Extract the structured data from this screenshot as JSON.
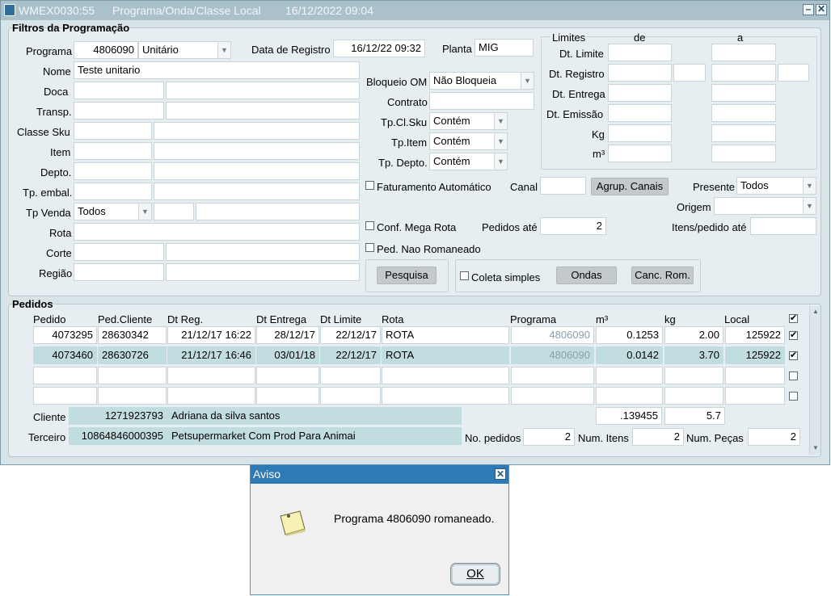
{
  "window": {
    "code": "WMEX0030:55",
    "title": "Programa/Onda/Classe Local",
    "datetime": "16/12/2022 09:04"
  },
  "filtros": {
    "title": "Filtros da Programação",
    "programa_label": "Programa",
    "programa_value": "4806090",
    "tipo_value": "Unitário",
    "data_registro_label": "Data de Registro",
    "data_registro_value": "16/12/22 09:32",
    "planta_label": "Planta",
    "planta_value": "MIG",
    "nome_label": "Nome",
    "nome_value": "Teste unitario",
    "doca_label": "Doca",
    "transp_label": "Transp.",
    "classe_sku_label": "Classe Sku",
    "item_label": "Item",
    "depto_label": "Depto.",
    "tp_embal_label": "Tp. embal.",
    "tp_venda_label": "Tp Venda",
    "tp_venda_value": "Todos",
    "rota_label": "Rota",
    "corte_label": "Corte",
    "regiao_label": "Região",
    "bloqueio_om_label": "Bloqueio OM",
    "bloqueio_om_value": "Não Bloqueia",
    "contrato_label": "Contrato",
    "tp_cl_sku_label": "Tp.Cl.Sku",
    "tp_cl_sku_value": "Contém",
    "tp_item_label": "Tp.Item",
    "tp_item_value": "Contém",
    "tp_depto_label": "Tp. Depto.",
    "tp_depto_value": "Contém",
    "limites_label": "Limites",
    "de_label": "de",
    "a_label": "a",
    "dt_limite_label": "Dt. Limite",
    "dt_registro_label": "Dt. Registro",
    "dt_entrega_label": "Dt. Entrega",
    "dt_emissao_label": "Dt. Emissão",
    "kg_label": "Kg",
    "m3_label": "m³",
    "faturamento_label": "Faturamento Automático",
    "faturamento_checked": false,
    "canal_label": "Canal",
    "agrup_canais_label": "Agrup. Canais",
    "presente_label": "Presente",
    "presente_value": "Todos",
    "origem_label": "Origem",
    "conf_mega_rota_label": "Conf. Mega Rota",
    "conf_mega_rota_checked": false,
    "pedidos_ate_label": "Pedidos até",
    "pedidos_ate_value": "2",
    "itens_pedido_label": "Itens/pedido até",
    "ped_nao_romaneado_label": "Ped. Nao Romaneado",
    "ped_nao_romaneado_checked": false,
    "pesquisa_label": "Pesquisa",
    "coleta_simples_label": "Coleta simples",
    "coleta_simples_checked": false,
    "ondas_label": "Ondas",
    "canc_rom_label": "Canc. Rom."
  },
  "pedidos": {
    "title": "Pedidos",
    "columns": [
      "Pedido",
      "Ped.Cliente",
      "Dt Reg.",
      "Dt Entrega",
      "Dt Limite",
      "Rota",
      "Programa",
      "m³",
      "kg",
      "Local"
    ],
    "header_checked": true,
    "rows": [
      {
        "pedido": "4073295",
        "ped_cliente": "28630342",
        "dt_reg": "21/12/17 16:22",
        "dt_entrega": "28/12/17",
        "dt_limite": "22/12/17",
        "rota": "ROTA",
        "programa": "4806090",
        "m3": "0.1253",
        "kg": "2.00",
        "local": "125922",
        "checked": true
      },
      {
        "pedido": "4073460",
        "ped_cliente": "28630726",
        "dt_reg": "21/12/17 16:46",
        "dt_entrega": "03/01/18",
        "dt_limite": "22/12/17",
        "rota": "ROTA",
        "programa": "4806090",
        "m3": "0.0142",
        "kg": "3.70",
        "local": "125922",
        "checked": true
      },
      {
        "pedido": "",
        "ped_cliente": "",
        "dt_reg": "",
        "dt_entrega": "",
        "dt_limite": "",
        "rota": "",
        "programa": "",
        "m3": "",
        "kg": "",
        "local": "",
        "checked": false
      },
      {
        "pedido": "",
        "ped_cliente": "",
        "dt_reg": "",
        "dt_entrega": "",
        "dt_limite": "",
        "rota": "",
        "programa": "",
        "m3": "",
        "kg": "",
        "local": "",
        "checked": false
      }
    ],
    "cliente_label": "Cliente",
    "cliente_code": "1271923793",
    "cliente_name": "Adriana da silva santos",
    "terceiro_label": "Terceiro",
    "terceiro_code": "10864846000395",
    "terceiro_name": "Petsupermarket Com Prod Para Animai",
    "total_m3": ".139455",
    "total_kg": "5.7",
    "no_pedidos_label": "No. pedidos",
    "no_pedidos_value": "2",
    "num_itens_label": "Num. Itens",
    "num_itens_value": "2",
    "num_pecas_label": "Num. Peças",
    "num_pecas_value": "2"
  },
  "dialog": {
    "title": "Aviso",
    "message": "Programa 4806090 romaneado.",
    "ok_label": "OK"
  },
  "colors": {
    "window_bg": "#d8e4e8",
    "titlebar_bg": "#aac1cc",
    "selected_row": "#c2dde0",
    "dialog_title": "#2e7ab5"
  }
}
